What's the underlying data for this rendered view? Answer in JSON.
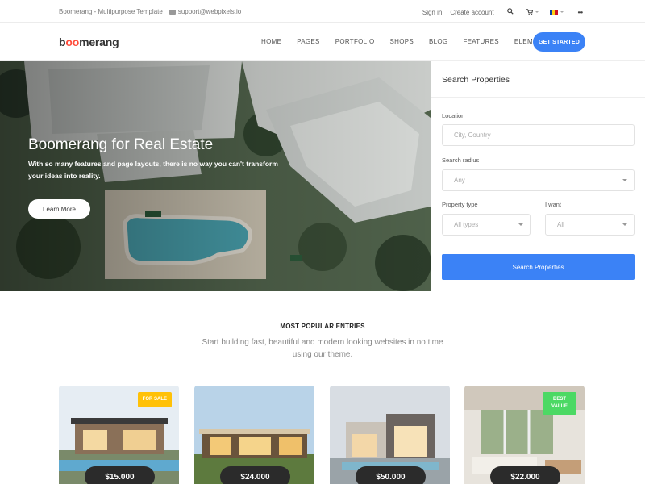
{
  "topbar": {
    "site_name": "Boomerang - Multipurpose Template",
    "email": "support@webpixels.io",
    "signin": "Sign in",
    "create_account": "Create account",
    "search_icon": "search-icon",
    "cart_icon": "cart-icon",
    "language_flag": "romania-flag-icon",
    "more_icon": "ellipsis-icon"
  },
  "nav": {
    "logo_pre": "b",
    "logo_oo": "oo",
    "logo_post": "merang",
    "items": [
      "HOME",
      "PAGES",
      "PORTFOLIO",
      "SHOPS",
      "BLOG",
      "FEATURES",
      "ELEMENTS"
    ],
    "cta": "GET STARTED"
  },
  "hero": {
    "title": "Boomerang for Real Estate",
    "text": "With so many features and page layouts, there is no way you can't transform your ideas into reality.",
    "button": "Learn More"
  },
  "search_panel": {
    "title": "Search Properties",
    "location_label": "Location",
    "location_placeholder": "City, Country",
    "radius_label": "Search radius",
    "radius_value": "Any",
    "type_label": "Property type",
    "type_value": "All types",
    "want_label": "I want",
    "want_value": "All",
    "submit": "Search Properties"
  },
  "popular": {
    "title": "MOST POPULAR ENTRIES",
    "subtitle": "Start building fast, beautiful and modern looking websites in no time using our theme."
  },
  "cards": [
    {
      "price": "$15.000",
      "badge": "FOR SALE",
      "badge_color": "#ffc107"
    },
    {
      "price": "$24.000",
      "badge": "",
      "badge_color": ""
    },
    {
      "price": "$50.000",
      "badge": "",
      "badge_color": ""
    },
    {
      "price": "$22.000",
      "badge": "BEST VALUE",
      "badge_color": "#4cd964"
    }
  ],
  "colors": {
    "accent": "#3b82f6",
    "logo_accent": "#ff4c3b",
    "price_pill": "#2b2b2b"
  }
}
